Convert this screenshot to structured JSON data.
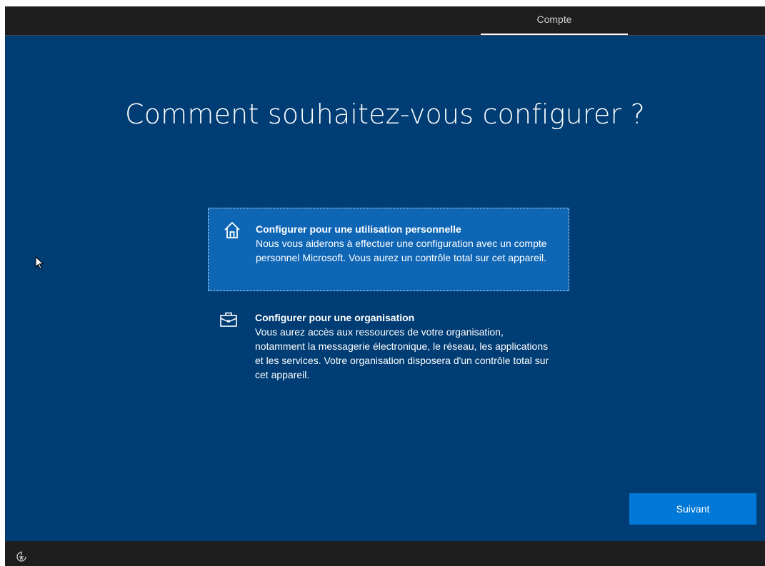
{
  "topbar": {
    "tab_label": "Compte"
  },
  "main": {
    "title": "Comment souhaitez-vous configurer ?",
    "options": [
      {
        "title": "Configurer pour une utilisation personnelle",
        "description": "Nous vous aiderons à effectuer une configuration avec un compte personnel Microsoft. Vous aurez un contrôle total sur cet appareil.",
        "icon": "home-icon",
        "selected": true
      },
      {
        "title": "Configurer pour une organisation",
        "description": "Vous aurez accès aux ressources de votre organisation, notamment la messagerie électronique, le réseau, les applications et les services. Votre organisation disposera d'un contrôle total sur cet appareil.",
        "icon": "briefcase-icon",
        "selected": false
      }
    ],
    "next_label": "Suivant"
  },
  "bottombar": {
    "icon": "accessibility-icon"
  },
  "colors": {
    "background": "#003d74",
    "selected_option": "#0f66b5",
    "button": "#0078d7",
    "chrome": "#1e1e1e"
  }
}
